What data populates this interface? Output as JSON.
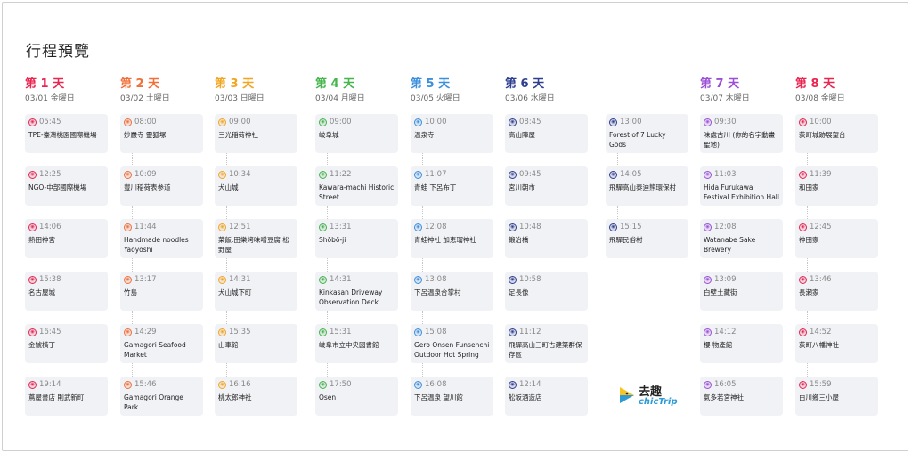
{
  "title": "行程預覽",
  "brand": {
    "name_cn": "去趣",
    "name_en": "chicTrip"
  },
  "days": [
    {
      "label": "第 1 天",
      "date": "03/01 金曜日",
      "color": "#e8264f",
      "items": [
        {
          "time": "05:45",
          "name": "TPE-臺灣桃園國際機場"
        },
        {
          "time": "12:25",
          "name": "NGO-中部國際機場"
        },
        {
          "time": "14:06",
          "name": "熱田神宮"
        },
        {
          "time": "15:38",
          "name": "名古屋城"
        },
        {
          "time": "16:45",
          "name": "金鯱橫丁"
        },
        {
          "time": "19:14",
          "name": "蔦屋書店 則武新町"
        }
      ]
    },
    {
      "label": "第 2 天",
      "date": "03/02 土曜日",
      "color": "#f0703a",
      "items": [
        {
          "time": "08:00",
          "name": "妙嚴寺 靈狐塚"
        },
        {
          "time": "10:09",
          "name": "豐川稲荷表参道"
        },
        {
          "time": "11:44",
          "name": "Handmade noodles Yaoyoshi"
        },
        {
          "time": "13:17",
          "name": "竹島"
        },
        {
          "time": "14:29",
          "name": "Gamagori Seafood Market"
        },
        {
          "time": "15:46",
          "name": "Gamagori Orange Park"
        }
      ]
    },
    {
      "label": "第 3 天",
      "date": "03/03 日曜日",
      "color": "#f2a521",
      "items": [
        {
          "time": "09:00",
          "name": "三光稲荷神社"
        },
        {
          "time": "10:34",
          "name": "犬山城"
        },
        {
          "time": "12:51",
          "name": "菜飯.田樂烤味噌豆腐 松野屋"
        },
        {
          "time": "14:31",
          "name": "犬山城下町"
        },
        {
          "time": "15:35",
          "name": "山車館"
        },
        {
          "time": "16:16",
          "name": "桃太郎神社"
        }
      ]
    },
    {
      "label": "第 4 天",
      "date": "03/04 月曜日",
      "color": "#45b54c",
      "items": [
        {
          "time": "09:00",
          "name": "岐阜城"
        },
        {
          "time": "11:22",
          "name": "Kawara-machi Historic Street"
        },
        {
          "time": "13:31",
          "name": "Shōbō-ji"
        },
        {
          "time": "14:31",
          "name": "Kinkasan Driveway Observation Deck"
        },
        {
          "time": "15:31",
          "name": "岐阜市立中央図書館"
        },
        {
          "time": "17:50",
          "name": "Osen"
        }
      ]
    },
    {
      "label": "第 5 天",
      "date": "03/05 火曜日",
      "color": "#3d8fdc",
      "items": [
        {
          "time": "10:00",
          "name": "温泉寺"
        },
        {
          "time": "11:07",
          "name": "青蛙 下呂布丁"
        },
        {
          "time": "12:08",
          "name": "青蛙神社 加恵瑠神社"
        },
        {
          "time": "13:08",
          "name": "下呂温泉合掌村"
        },
        {
          "time": "15:08",
          "name": "Gero Onsen Funsenchi Outdoor Hot Spring"
        },
        {
          "time": "16:08",
          "name": "下呂温泉 望川館"
        }
      ]
    },
    {
      "label": "第 6 天",
      "date": "03/06 水曜日",
      "color": "#2e3f8f",
      "items": [
        {
          "time": "08:45",
          "name": "高山陣屋"
        },
        {
          "time": "09:45",
          "name": "宮川朝市"
        },
        {
          "time": "10:48",
          "name": "鍛冶橋"
        },
        {
          "time": "10:58",
          "name": "足長像"
        },
        {
          "time": "11:12",
          "name": "飛驒高山三町古建築群保存區"
        },
        {
          "time": "12:14",
          "name": "舩坂酒造店"
        },
        {
          "time": "13:00",
          "name": "Forest of 7 Lucky Gods"
        },
        {
          "time": "14:05",
          "name": "飛驒高山泰迪熊環保村"
        },
        {
          "time": "15:15",
          "name": "飛驒民俗村"
        }
      ]
    },
    {
      "label": "第 7 天",
      "date": "03/07 木曜日",
      "color": "#9b4fd6",
      "items": [
        {
          "time": "09:30",
          "name": "味處古川 (你的名字動畫聖地)"
        },
        {
          "time": "11:03",
          "name": "Hida Furukawa Festival Exhibition Hall"
        },
        {
          "time": "12:08",
          "name": "Watanabe Sake Brewery"
        },
        {
          "time": "13:09",
          "name": "白壁土藏街"
        },
        {
          "time": "14:12",
          "name": "櫻 物產館"
        },
        {
          "time": "16:05",
          "name": "氣多若宮神社"
        }
      ]
    },
    {
      "label": "第 8 天",
      "date": "03/08 金曜日",
      "color": "#e8264f",
      "items": [
        {
          "time": "10:00",
          "name": "荻町城跡展望台"
        },
        {
          "time": "11:39",
          "name": "和田家"
        },
        {
          "time": "12:45",
          "name": "神田家"
        },
        {
          "time": "13:46",
          "name": "長瀬家"
        },
        {
          "time": "14:52",
          "name": "荻町八幡神社"
        },
        {
          "time": "15:59",
          "name": "白川鄉三小屋"
        }
      ]
    }
  ]
}
